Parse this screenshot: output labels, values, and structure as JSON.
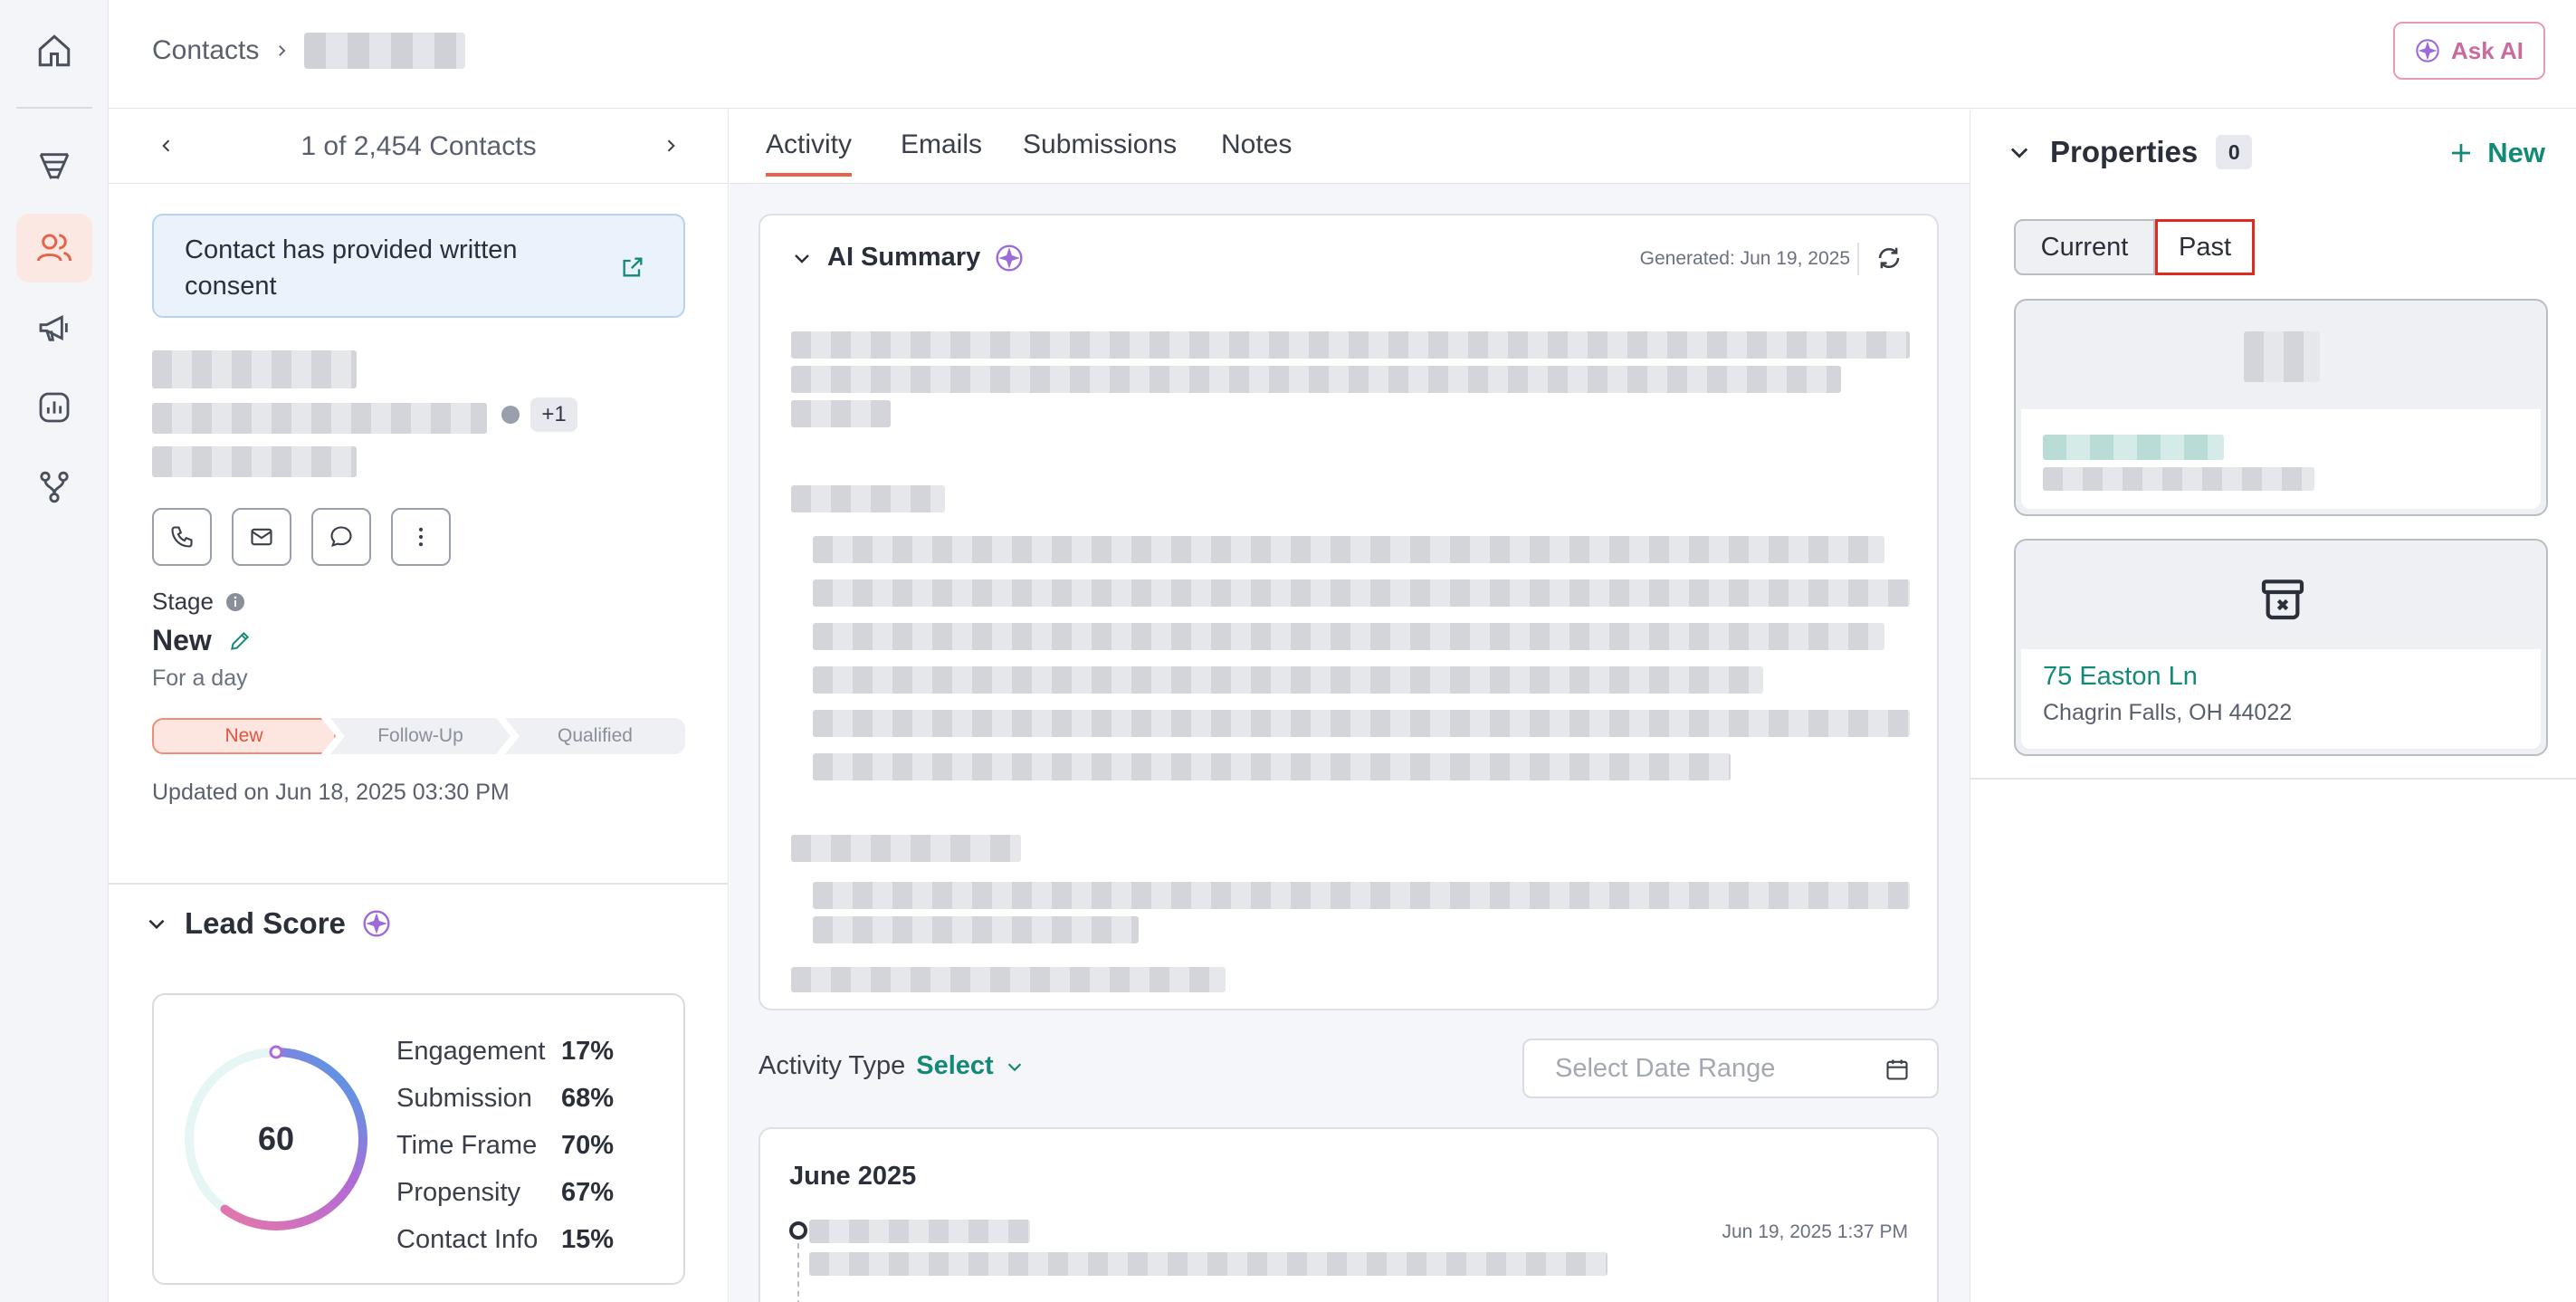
{
  "breadcrumb": {
    "root": "Contacts"
  },
  "header": {
    "ask_ai_label": "Ask AI"
  },
  "contact_nav": {
    "position_text": "1 of 2,454 Contacts"
  },
  "consent": {
    "text": "Contact has provided written consent"
  },
  "contact": {
    "extra_count": "+1"
  },
  "stage": {
    "label": "Stage",
    "value": "New",
    "duration": "For a day",
    "pipeline": [
      "New",
      "Follow-Up",
      "Qualified"
    ],
    "updated": "Updated on Jun 18, 2025 03:30 PM"
  },
  "lead_score": {
    "title": "Lead Score",
    "score": "60",
    "score_fraction": 0.6,
    "factors": [
      {
        "label": "Engagement",
        "value": "17%"
      },
      {
        "label": "Submission",
        "value": "68%"
      },
      {
        "label": "Time Frame",
        "value": "70%"
      },
      {
        "label": "Propensity",
        "value": "67%"
      },
      {
        "label": "Contact Info",
        "value": "15%"
      }
    ]
  },
  "tabs": [
    "Activity",
    "Emails",
    "Submissions",
    "Notes"
  ],
  "ai_summary": {
    "title": "AI Summary",
    "generated": "Generated: Jun 19, 2025"
  },
  "activity_filter": {
    "label": "Activity Type",
    "select": "Select",
    "date_placeholder": "Select Date Range"
  },
  "timeline": {
    "month": "June 2025",
    "entry_date": "Jun 19, 2025",
    "entry_time": "1:37 PM"
  },
  "properties": {
    "title": "Properties",
    "count": "0",
    "new_label": "New",
    "segments": [
      "Current",
      "Past"
    ],
    "past_address": "75 Easton Ln",
    "past_city": "Chagrin Falls, OH 44022"
  },
  "colors": {
    "accent": "#e36449",
    "teal": "#138a78",
    "highlight": "#e02b1f"
  }
}
